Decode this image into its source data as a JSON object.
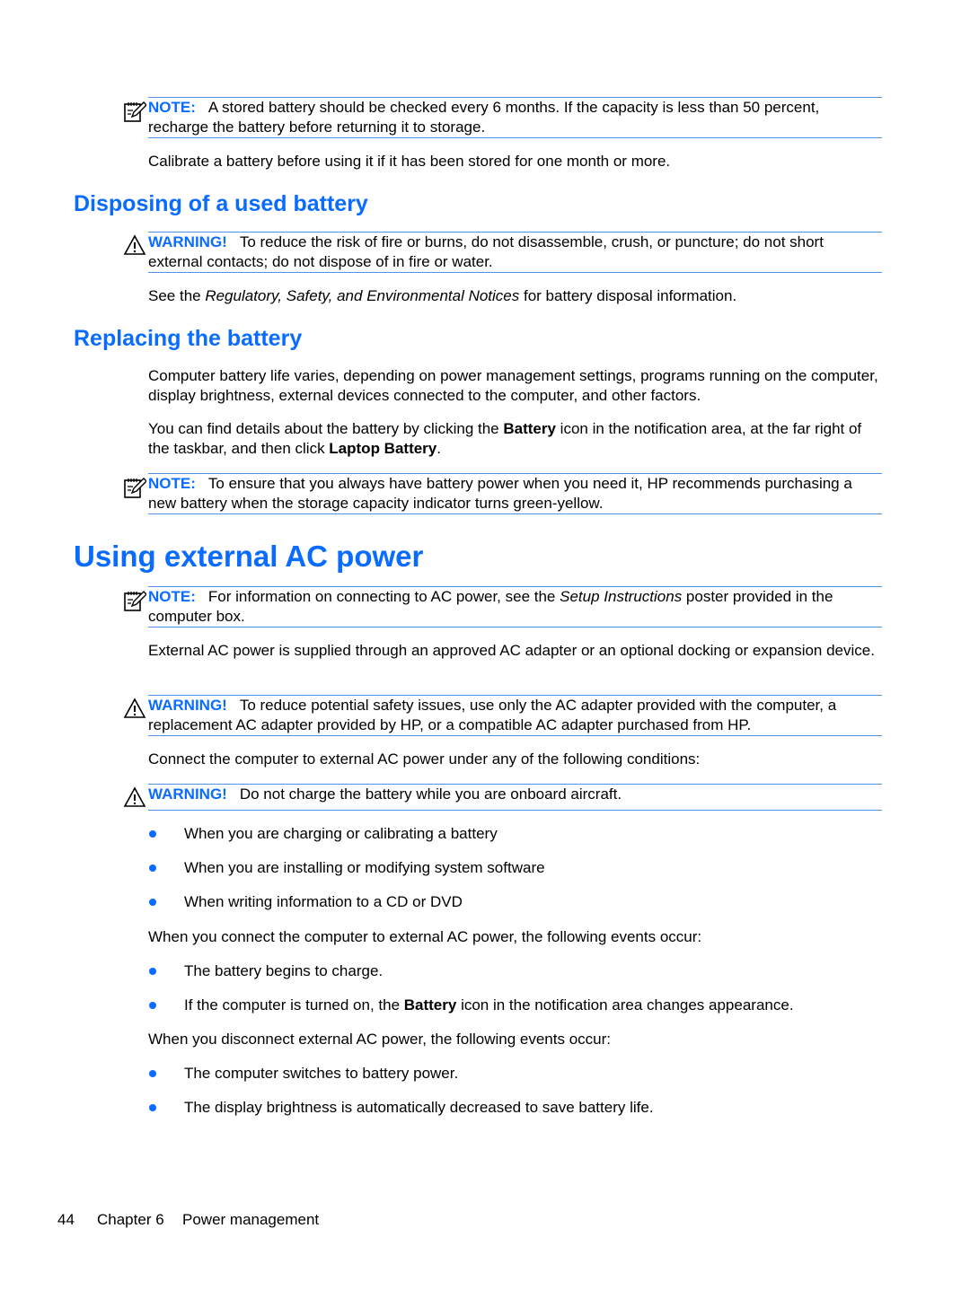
{
  "note1": {
    "label": "NOTE:",
    "text": "A stored battery should be checked every 6 months. If the capacity is less than 50 percent, recharge the battery before returning it to storage."
  },
  "para_calibrate": "Calibrate a battery before using it if it has been stored for one month or more.",
  "section_disposing": {
    "title": "Disposing of a used battery",
    "warning": {
      "label": "WARNING!",
      "text": "To reduce the risk of fire or burns, do not disassemble, crush, or puncture; do not short external contacts; do not dispose of in fire or water."
    },
    "para": {
      "pre": "See the ",
      "italic": "Regulatory, Safety, and Environmental Notices",
      "post": " for battery disposal information."
    }
  },
  "section_replacing": {
    "title": "Replacing the battery",
    "para1": "Computer battery life varies, depending on power management settings, programs running on the computer, display brightness, external devices connected to the computer, and other factors.",
    "para2": {
      "pre": "You can find details about the battery by clicking the ",
      "bold1": "Battery",
      "mid": " icon in the notification area, at the far right of the taskbar, and then click ",
      "bold2": "Laptop Battery",
      "post": "."
    },
    "note": {
      "label": "NOTE:",
      "text": "To ensure that you always have battery power when you need it, HP recommends purchasing a new battery when the storage capacity indicator turns green-yellow."
    }
  },
  "section_ac": {
    "title": "Using external AC power",
    "note": {
      "label": "NOTE:",
      "pre": "For information on connecting to AC power, see the ",
      "italic": "Setup Instructions",
      "post": " poster provided in the computer box."
    },
    "para1": "External AC power is supplied through an approved AC adapter or an optional docking or expansion device.",
    "warning1": {
      "label": "WARNING!",
      "text": "To reduce potential safety issues, use only the AC adapter provided with the computer, a replacement AC adapter provided by HP, or a compatible AC adapter purchased from HP."
    },
    "para2": "Connect the computer to external AC power under any of the following conditions:",
    "warning2": {
      "label": "WARNING!",
      "text": "Do not charge the battery while you are onboard aircraft."
    },
    "conditions": [
      "When you are charging or calibrating a battery",
      "When you are installing or modifying system software",
      "When writing information to a CD or DVD"
    ],
    "para3": "When you connect the computer to external AC power, the following events occur:",
    "connect_events": [
      {
        "text": "The battery begins to charge."
      },
      {
        "pre": "If the computer is turned on, the ",
        "bold": "Battery",
        "post": " icon in the notification area changes appearance."
      }
    ],
    "para4": "When you disconnect external AC power, the following events occur:",
    "disconnect_events": [
      "The computer switches to battery power.",
      "The display brightness is automatically decreased to save battery life."
    ]
  },
  "footer": {
    "page_number": "44",
    "chapter": "Chapter 6",
    "chapter_title": "Power management"
  },
  "colors": {
    "accent": "#0a6cff",
    "rule": "#4f93e8"
  }
}
